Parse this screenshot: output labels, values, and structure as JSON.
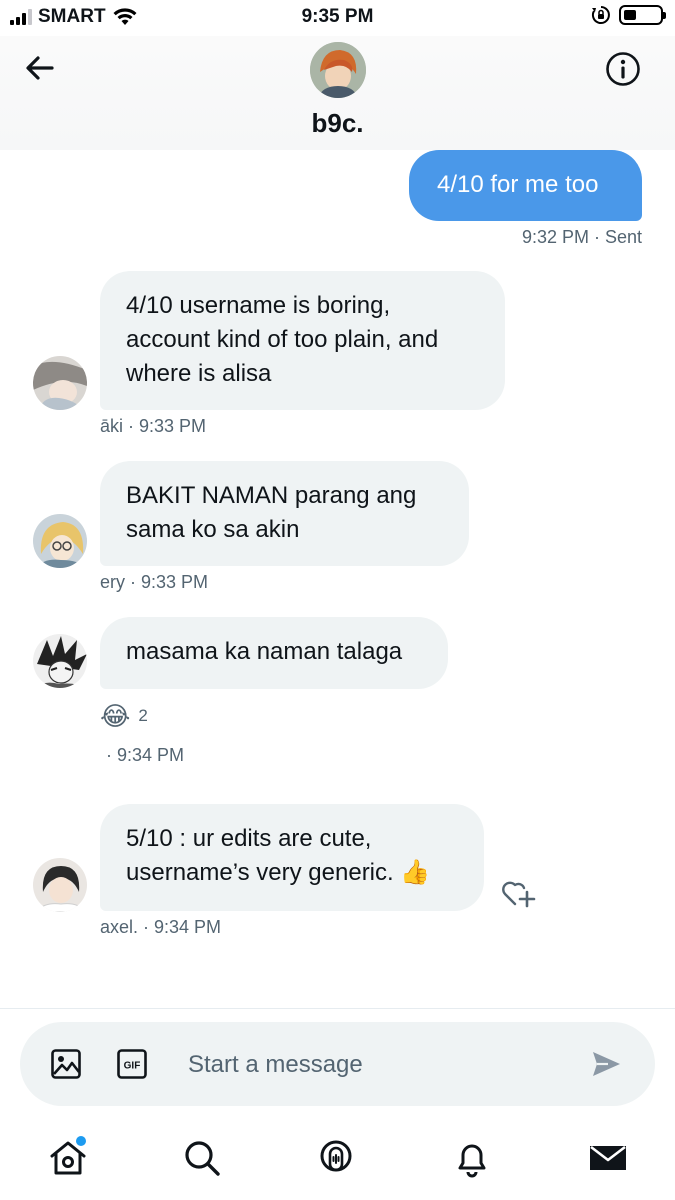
{
  "status_bar": {
    "carrier": "SMART",
    "time": "9:35 PM"
  },
  "header": {
    "title": "b9c."
  },
  "messages": [
    {
      "text": "4/10 for me too",
      "meta": "9:32 PM · Sent"
    },
    {
      "text": "4/10 username is boring, account kind of too plain, and where is alisa",
      "meta": "āki · 9:33 PM"
    },
    {
      "text": "BAKIT NAMAN parang ang sama ko sa akin",
      "meta": "ery · 9:33 PM"
    },
    {
      "text": "masama ka naman talaga",
      "meta": "· 9:34 PM",
      "reaction": {
        "emoji": "😂",
        "count": "2"
      }
    },
    {
      "text": "5/10 : ur edits are cute, username’s very generic. 👍",
      "meta": "axel. · 9:34 PM"
    }
  ],
  "composer": {
    "placeholder": "Start a message"
  },
  "icons": {
    "back": "arrow-left-icon",
    "info": "info-icon",
    "image": "image-icon",
    "gif": "gif-icon",
    "send": "send-icon",
    "home": "home-icon",
    "search": "search-icon",
    "spaces": "spaces-icon",
    "notifications": "bell-icon",
    "messages": "envelope-icon",
    "react": "heart-add-icon"
  },
  "colors": {
    "sent_bubble": "#4a98e9",
    "received_bubble": "#eff3f4",
    "meta_text": "#536471",
    "accent": "#1d9bf0"
  }
}
